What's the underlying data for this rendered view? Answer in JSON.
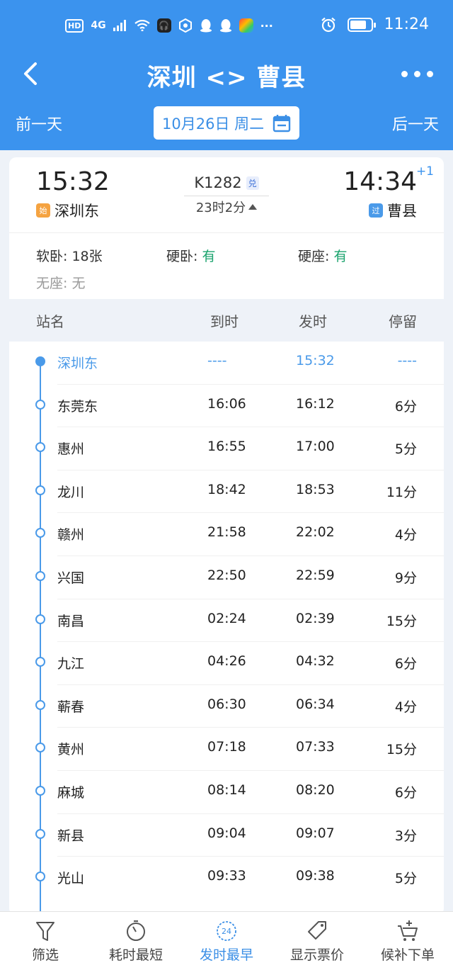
{
  "status_bar": {
    "left_badges": [
      "HD",
      "4G"
    ],
    "time": "11:24",
    "battery_level": 0.8
  },
  "nav": {
    "title": "深圳 <> 曹县",
    "prev_day": "前一天",
    "next_day": "后一天",
    "date": "10月26日 周二"
  },
  "train": {
    "dep_time": "15:32",
    "arr_time": "14:34",
    "arr_plus": "+1",
    "dep_station": "深圳东",
    "arr_station": "曹县",
    "dep_tag": "始",
    "arr_tag": "过",
    "number": "K1282",
    "exchange_tag": "兑",
    "duration": "23时2分"
  },
  "seats": [
    {
      "label": "软卧: ",
      "value": "18张",
      "style": "normal"
    },
    {
      "label": "硬卧: ",
      "value": "有",
      "style": "green"
    },
    {
      "label": "硬座: ",
      "value": "有",
      "style": "green"
    },
    {
      "label": "无座: ",
      "value": "无",
      "style": "muted"
    }
  ],
  "table_head": {
    "station": "站名",
    "arrive": "到时",
    "depart": "发时",
    "stay": "停留"
  },
  "stops": [
    {
      "name": "深圳东",
      "arrive": "----",
      "depart": "15:32",
      "stay": "----"
    },
    {
      "name": "东莞东",
      "arrive": "16:06",
      "depart": "16:12",
      "stay": "6分"
    },
    {
      "name": "惠州",
      "arrive": "16:55",
      "depart": "17:00",
      "stay": "5分"
    },
    {
      "name": "龙川",
      "arrive": "18:42",
      "depart": "18:53",
      "stay": "11分"
    },
    {
      "name": "赣州",
      "arrive": "21:58",
      "depart": "22:02",
      "stay": "4分"
    },
    {
      "name": "兴国",
      "arrive": "22:50",
      "depart": "22:59",
      "stay": "9分"
    },
    {
      "name": "南昌",
      "arrive": "02:24",
      "depart": "02:39",
      "stay": "15分"
    },
    {
      "name": "九江",
      "arrive": "04:26",
      "depart": "04:32",
      "stay": "6分"
    },
    {
      "name": "蕲春",
      "arrive": "06:30",
      "depart": "06:34",
      "stay": "4分"
    },
    {
      "name": "黄州",
      "arrive": "07:18",
      "depart": "07:33",
      "stay": "15分"
    },
    {
      "name": "麻城",
      "arrive": "08:14",
      "depart": "08:20",
      "stay": "6分"
    },
    {
      "name": "新县",
      "arrive": "09:04",
      "depart": "09:07",
      "stay": "3分"
    },
    {
      "name": "光山",
      "arrive": "09:33",
      "depart": "09:38",
      "stay": "5分"
    }
  ],
  "bottom_tabs": [
    {
      "label": "筛选",
      "icon": "filter-icon",
      "active": false
    },
    {
      "label": "耗时最短",
      "icon": "stopwatch-icon",
      "active": false
    },
    {
      "label": "发时最早",
      "icon": "clock-24-icon",
      "active": true,
      "badge": "24"
    },
    {
      "label": "显示票价",
      "icon": "price-tag-icon",
      "active": false
    },
    {
      "label": "候补下单",
      "icon": "cart-add-icon",
      "active": false
    }
  ],
  "colors": {
    "header_blue": "#3b93ee",
    "accent_blue": "#4a9ae9",
    "green": "#1aa36d",
    "start_tag": "#f5a341"
  }
}
